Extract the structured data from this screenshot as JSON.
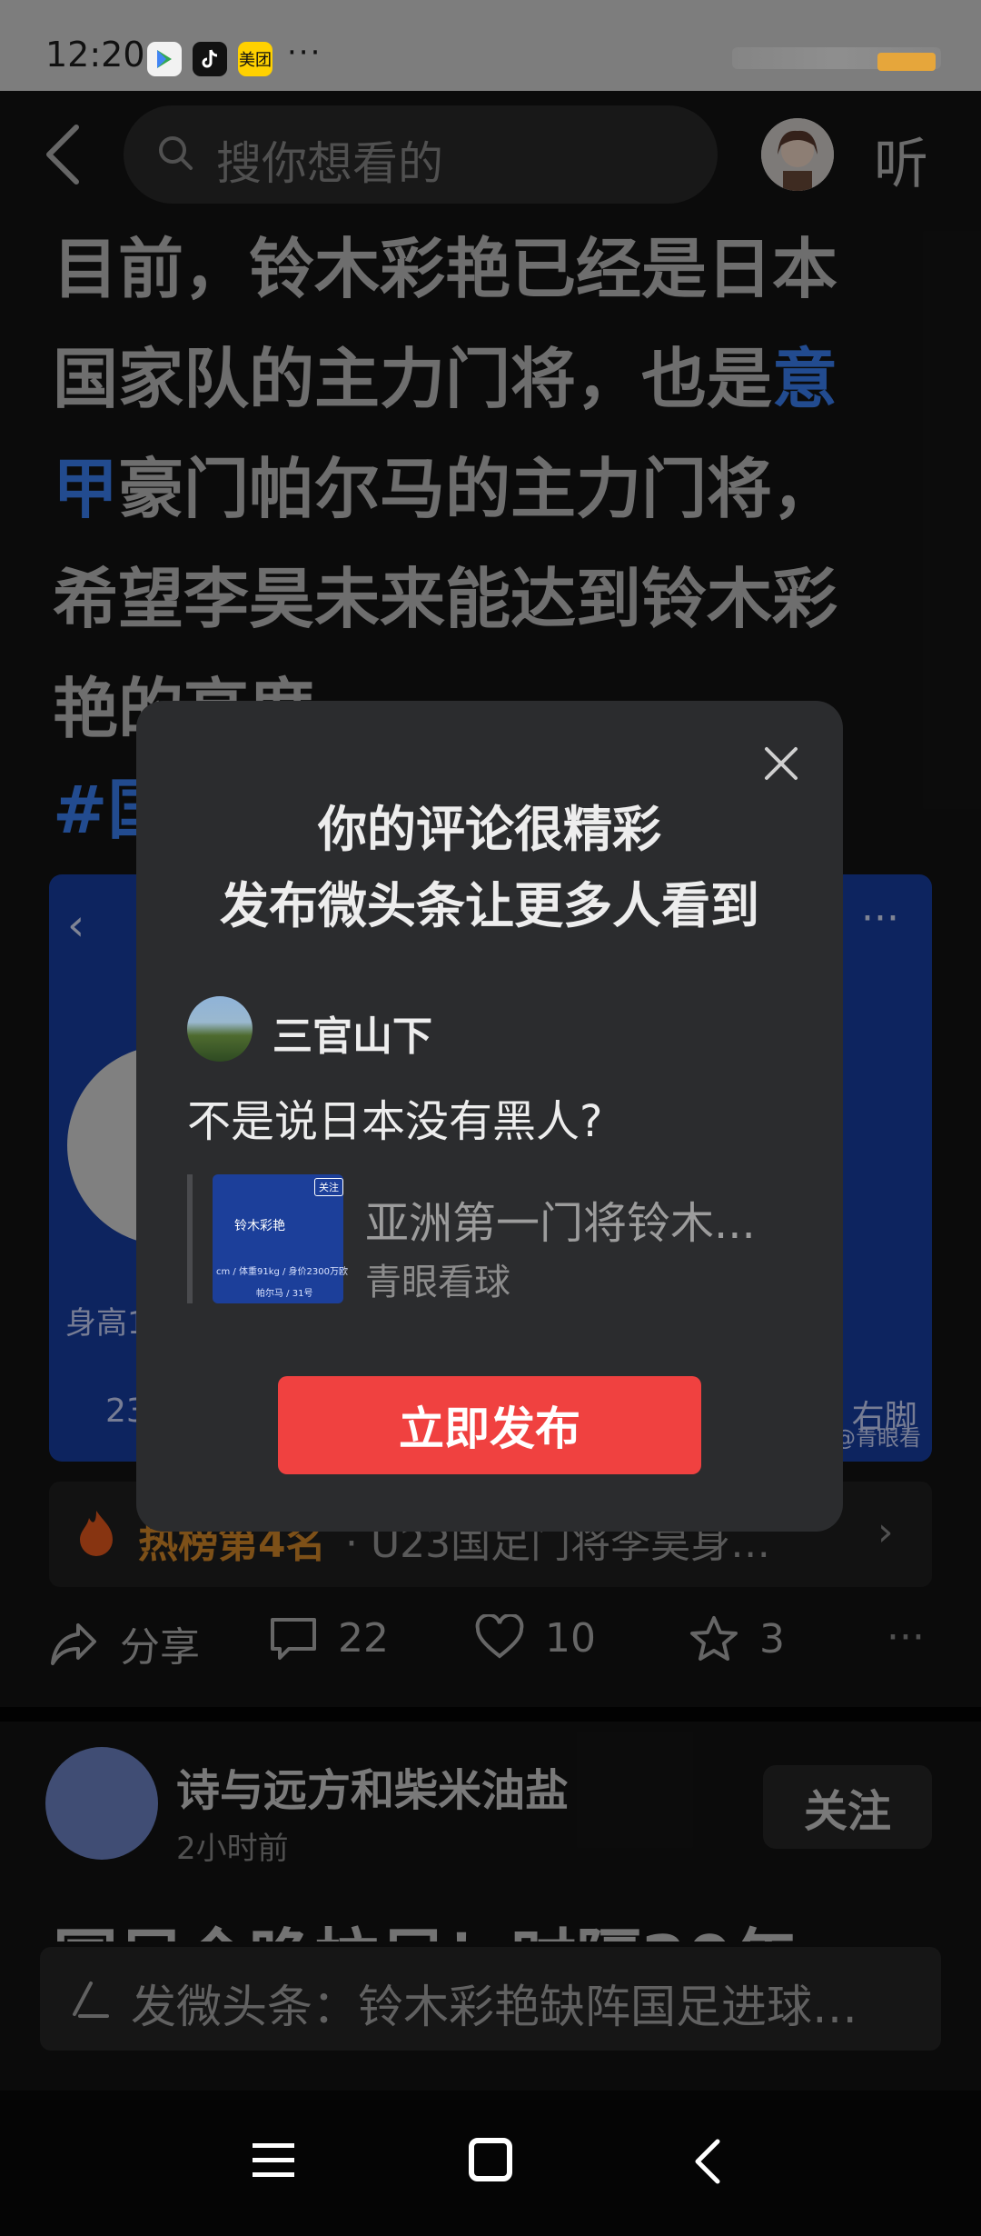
{
  "status_bar": {
    "time": "12:20",
    "app_icons": [
      "google-play-icon",
      "tiktok-icon",
      "meituan-icon"
    ],
    "meituan_label": "美团",
    "more": "···"
  },
  "top_nav": {
    "search_placeholder": "搜你想看的",
    "listen_label": "听"
  },
  "article": {
    "line1": "目前，铃木彩艳已经是日本",
    "line2_a": "国家队的主力门将，也是",
    "line2_b": "意",
    "line3_a": "甲",
    "line3_b": "豪门帕尔马的主力门将，",
    "line4": "希望李昊未来能达到铃木彩",
    "line5": "艳的高度",
    "hashtag": "#国"
  },
  "blue_card": {
    "height_label": "身高1",
    "number_label": "23",
    "foot_label": "/ 右脚",
    "watermark": "@青眼看"
  },
  "hot_bar": {
    "rank": "热榜第4名",
    "text": "· U23国足门将李昊身…"
  },
  "actions": {
    "share": "分享",
    "comments": "22",
    "likes": "10",
    "favorites": "3"
  },
  "post2": {
    "author": "诗与远方和柴米油盐",
    "time": "2小时前",
    "follow": "关注",
    "title": "国足今晚拉尼！时隔20年"
  },
  "composer": {
    "text": "发微头条：铃木彩艳缺阵国足进球…"
  },
  "dialog": {
    "title_line1": "你的评论很精彩",
    "title_line2": "发布微头条让更多人看到",
    "username": "三官山下",
    "comment": "不是说日本没有黑人?",
    "quoted_title": "亚洲第一门将铃木...",
    "quoted_source": "青眼看球",
    "thumb_name": "铃木彩艳",
    "thumb_follow": "关注",
    "thumb_sub": "cm / 体重91kg / 身价2300万欧",
    "thumb_sub2": "帕尔马 / 31号",
    "publish_button": "立即发布"
  }
}
